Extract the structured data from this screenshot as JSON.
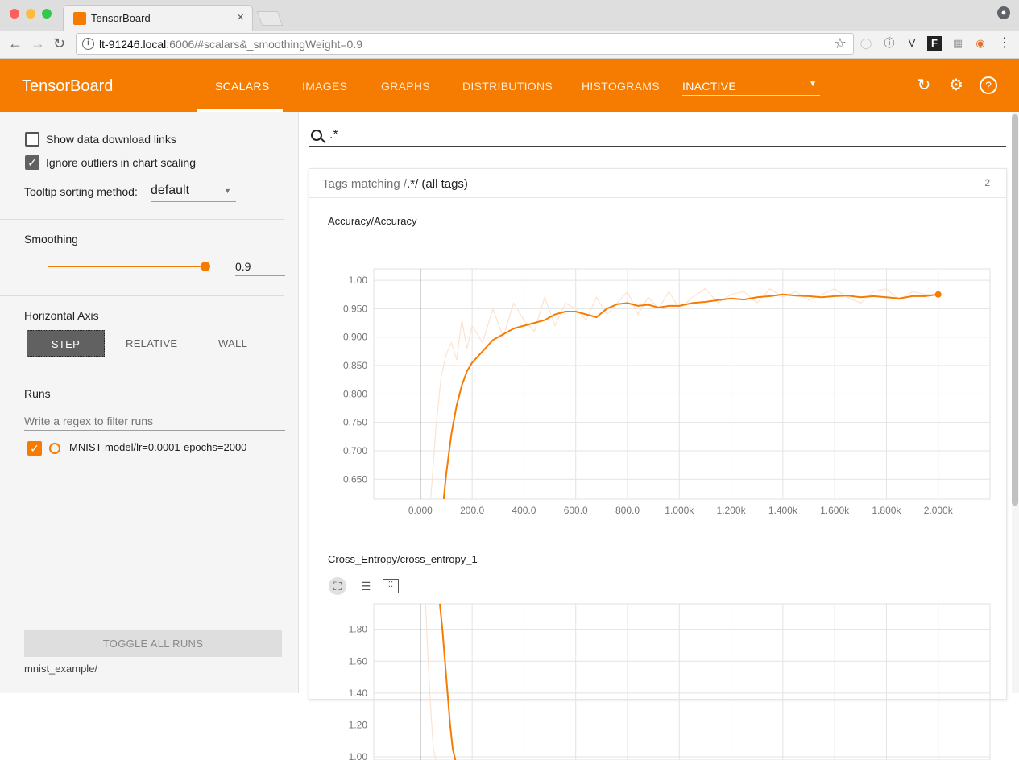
{
  "browser": {
    "tab_title": "TensorBoard",
    "url_host": "lt-91246.local",
    "url_rest": ":6006/#scalars&_smoothingWeight=0.9",
    "icons": [
      "back-icon",
      "forward-icon",
      "reload-icon",
      "info-icon",
      "star-icon",
      "extension-icons",
      "menu-icon"
    ]
  },
  "header": {
    "brand": "TensorBoard",
    "tabs": [
      "SCALARS",
      "IMAGES",
      "GRAPHS",
      "DISTRIBUTIONS",
      "HISTOGRAMS"
    ],
    "active_tab": "SCALARS",
    "inactive_label": "INACTIVE",
    "accent": "#f57c00"
  },
  "sidebar": {
    "show_links_label": "Show data download links",
    "show_links_checked": false,
    "ignore_outliers_label": "Ignore outliers in chart scaling",
    "ignore_outliers_checked": true,
    "tooltip_label": "Tooltip sorting method:",
    "tooltip_value": "default",
    "smoothing_title": "Smoothing",
    "smoothing_value": "0.9",
    "smoothing_fraction": 0.9,
    "axis_title": "Horizontal Axis",
    "axis_options": [
      "STEP",
      "RELATIVE",
      "WALL"
    ],
    "axis_selected": "STEP",
    "runs_title": "Runs",
    "runs_filter_placeholder": "Write a regex to filter runs",
    "run_name": "MNIST-model/lr=0.0001-epochs=2000",
    "toggle_all_label": "TOGGLE ALL RUNS",
    "logdir": "mnist_example/"
  },
  "main": {
    "search_value": ".*",
    "tags_prefix": "Tags matching /",
    "tags_regex": ".*",
    "tags_suffix": "/ (all tags)",
    "tag_count": "2",
    "chart1_title": "Accuracy/Accuracy",
    "chart2_title": "Cross_Entropy/cross_entropy_1"
  },
  "chart_data": [
    {
      "type": "line",
      "title": "Accuracy/Accuracy",
      "ylim": [
        0.615,
        1.02
      ],
      "xlim": [
        -180,
        2200
      ],
      "yticks": [
        0.65,
        0.7,
        0.75,
        0.8,
        0.85,
        0.9,
        0.95,
        1.0
      ],
      "yticklabels": [
        "0.650",
        "0.700",
        "0.750",
        "0.800",
        "0.850",
        "0.900",
        "0.950",
        "1.00"
      ],
      "xticks": [
        0,
        200,
        400,
        600,
        800,
        1000,
        1200,
        1400,
        1600,
        1800,
        2000
      ],
      "xticklabels": [
        "0.000",
        "200.0",
        "400.0",
        "600.0",
        "800.0",
        "1.000k",
        "1.200k",
        "1.400k",
        "1.600k",
        "1.800k",
        "2.000k"
      ],
      "series": [
        {
          "role": "smoothed",
          "color": "#f57c00",
          "x": [
            90,
            100,
            120,
            140,
            160,
            180,
            200,
            240,
            280,
            320,
            360,
            400,
            440,
            480,
            520,
            560,
            600,
            640,
            680,
            720,
            760,
            800,
            840,
            880,
            920,
            960,
            1000,
            1050,
            1100,
            1150,
            1200,
            1250,
            1300,
            1350,
            1400,
            1450,
            1500,
            1550,
            1600,
            1650,
            1700,
            1750,
            1800,
            1850,
            1900,
            1950,
            2000
          ],
          "y": [
            0.615,
            0.66,
            0.73,
            0.78,
            0.815,
            0.84,
            0.855,
            0.875,
            0.895,
            0.905,
            0.915,
            0.92,
            0.925,
            0.93,
            0.94,
            0.945,
            0.945,
            0.94,
            0.935,
            0.95,
            0.958,
            0.96,
            0.955,
            0.957,
            0.952,
            0.955,
            0.955,
            0.96,
            0.962,
            0.965,
            0.968,
            0.966,
            0.97,
            0.972,
            0.975,
            0.973,
            0.972,
            0.97,
            0.972,
            0.973,
            0.97,
            0.972,
            0.97,
            0.968,
            0.972,
            0.972,
            0.975
          ]
        },
        {
          "role": "raw",
          "color": "#fbe3d1",
          "x": [
            40,
            60,
            80,
            100,
            120,
            140,
            160,
            180,
            200,
            240,
            280,
            320,
            360,
            400,
            440,
            480,
            520,
            560,
            600,
            640,
            680,
            720,
            760,
            800,
            840,
            880,
            920,
            960,
            1000,
            1050,
            1100,
            1150,
            1200,
            1250,
            1300,
            1350,
            1400,
            1450,
            1500,
            1550,
            1600,
            1650,
            1700,
            1750,
            1800,
            1850,
            1900,
            1950,
            2000
          ],
          "y": [
            0.615,
            0.74,
            0.83,
            0.87,
            0.89,
            0.86,
            0.93,
            0.88,
            0.92,
            0.89,
            0.95,
            0.9,
            0.96,
            0.93,
            0.91,
            0.97,
            0.92,
            0.96,
            0.95,
            0.93,
            0.97,
            0.94,
            0.96,
            0.98,
            0.94,
            0.97,
            0.95,
            0.98,
            0.95,
            0.97,
            0.985,
            0.96,
            0.975,
            0.98,
            0.96,
            0.985,
            0.97,
            0.98,
            0.965,
            0.975,
            0.985,
            0.97,
            0.96,
            0.98,
            0.985,
            0.965,
            0.98,
            0.975,
            0.975
          ]
        }
      ]
    },
    {
      "type": "line",
      "title": "Cross_Entropy/cross_entropy_1",
      "ylim": [
        0.98,
        1.96
      ],
      "xlim": [
        -180,
        2200
      ],
      "yticks": [
        1.0,
        1.2,
        1.4,
        1.6,
        1.8
      ],
      "yticklabels": [
        "1.00",
        "1.20",
        "1.40",
        "1.60",
        "1.80"
      ],
      "xticks": [
        0,
        200,
        400,
        600,
        800,
        1000,
        1200,
        1400,
        1600,
        1800,
        2000
      ],
      "series": [
        {
          "role": "smoothed",
          "color": "#f57c00",
          "x": [
            75,
            85,
            95,
            105,
            115,
            125,
            135
          ],
          "y": [
            1.96,
            1.8,
            1.6,
            1.4,
            1.2,
            1.05,
            0.98
          ]
        },
        {
          "role": "raw",
          "color": "#fbe3d1",
          "x": [
            20,
            30,
            40,
            50,
            60
          ],
          "y": [
            1.96,
            1.6,
            1.3,
            1.05,
            0.98
          ]
        }
      ]
    }
  ]
}
